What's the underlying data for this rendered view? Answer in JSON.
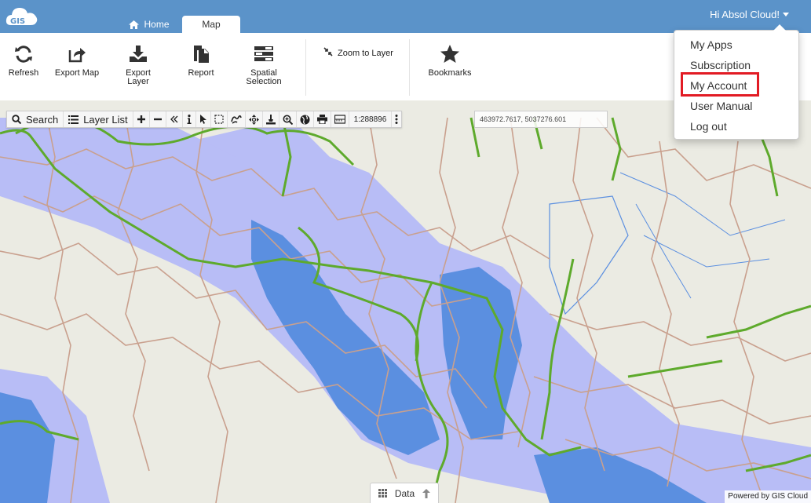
{
  "app": {
    "logo_text": "GIS"
  },
  "tabs": [
    {
      "label": "Home"
    },
    {
      "label": "Map"
    }
  ],
  "user": {
    "greeting": "Hi Absol Cloud!"
  },
  "ribbon": {
    "refresh": "Refresh",
    "export_map": "Export Map",
    "export_layer_line1": "Export",
    "export_layer_line2": "Layer",
    "report": "Report",
    "spatial_line1": "Spatial",
    "spatial_line2": "Selection",
    "zoom_to_layer": "Zoom to Layer",
    "bookmarks": "Bookmarks"
  },
  "map_toolbar": {
    "search": "Search",
    "layer_list": "Layer List",
    "scale": "1:288896",
    "coordinates": "463972.7617, 5037276.601"
  },
  "menu": {
    "items": [
      "My Apps",
      "Subscription",
      "My Account",
      "User Manual",
      "Log out"
    ],
    "highlighted": "My Account"
  },
  "bottom": {
    "data_tab": "Data",
    "powered_by": "Powered by GIS Cloud"
  },
  "colors": {
    "header": "#5b93c9",
    "flood_light": "#b8bdf6",
    "flood_dark": "#5b8fe0",
    "boundary": "#c9a08e",
    "rivers": "#5eaa2c",
    "highlight": "#e21b24"
  }
}
